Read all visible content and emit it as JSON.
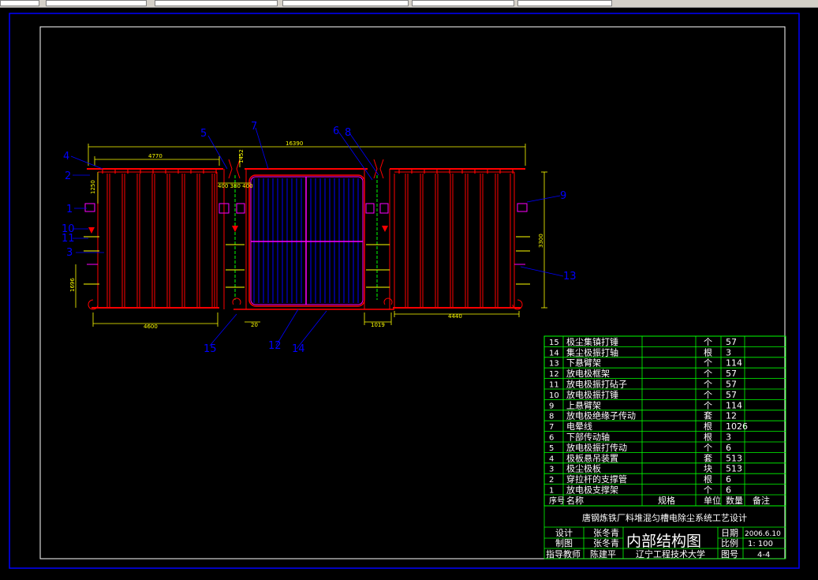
{
  "drawing": {
    "dimensions": {
      "overall": "16390",
      "left_width": "4770",
      "right_top": "1452",
      "mid_spacing": "400 380 400",
      "left_height": "1250",
      "right_height": "3300",
      "left_lower": "1696",
      "bottom_left": "4600",
      "bottom_gap": "20",
      "bottom_mid": "1019",
      "bottom_right": "4440"
    },
    "callouts": {
      "c1": "4",
      "c2": "2",
      "c3": "5",
      "c4": "7",
      "c5": "6",
      "c6": "8",
      "c7": "1",
      "c8": "10",
      "c9": "11",
      "c10": "3",
      "c11": "9",
      "c12": "13",
      "c13": "15",
      "c14": "12",
      "c15": "14"
    }
  },
  "bom": {
    "rows": [
      {
        "no": "15",
        "name": "极尘集镇打锤",
        "spec": "",
        "unit": "个",
        "qty": "57",
        "note": ""
      },
      {
        "no": "14",
        "name": "集尘极振打轴",
        "spec": "",
        "unit": "根",
        "qty": "3",
        "note": ""
      },
      {
        "no": "13",
        "name": "下悬臂架",
        "spec": "",
        "unit": "个",
        "qty": "114",
        "note": ""
      },
      {
        "no": "12",
        "name": "放电极框架",
        "spec": "",
        "unit": "个",
        "qty": "57",
        "note": ""
      },
      {
        "no": "11",
        "name": "放电极振打砧子",
        "spec": "",
        "unit": "个",
        "qty": "57",
        "note": ""
      },
      {
        "no": "10",
        "name": "放电极振打锤",
        "spec": "",
        "unit": "个",
        "qty": "57",
        "note": ""
      },
      {
        "no": "9",
        "name": "上悬臂架",
        "spec": "",
        "unit": "个",
        "qty": "114",
        "note": ""
      },
      {
        "no": "8",
        "name": "放电极绝缘子传动",
        "spec": "",
        "unit": "套",
        "qty": "12",
        "note": ""
      },
      {
        "no": "7",
        "name": "电晕线",
        "spec": "",
        "unit": "根",
        "qty": "1026",
        "note": ""
      },
      {
        "no": "6",
        "name": "下部传动轴",
        "spec": "",
        "unit": "根",
        "qty": "3",
        "note": ""
      },
      {
        "no": "5",
        "name": "放电极振打传动",
        "spec": "",
        "unit": "个",
        "qty": "6",
        "note": ""
      },
      {
        "no": "4",
        "name": "极板悬吊装置",
        "spec": "",
        "unit": "套",
        "qty": "513",
        "note": ""
      },
      {
        "no": "3",
        "name": "极尘极板",
        "spec": "",
        "unit": "块",
        "qty": "513",
        "note": ""
      },
      {
        "no": "2",
        "name": "穿拉杆的支撑管",
        "spec": "",
        "unit": "根",
        "qty": "6",
        "note": ""
      },
      {
        "no": "1",
        "name": "放电极支撑架",
        "spec": "",
        "unit": "个",
        "qty": "6",
        "note": ""
      }
    ],
    "header": {
      "no": "序号",
      "name": "名称",
      "spec": "规格",
      "unit": "单位",
      "qty": "数量",
      "note": "备注"
    }
  },
  "title_block": {
    "project": "唐钢炼铁厂料堆混匀槽电除尘系统工艺设计",
    "design_label": "设计",
    "design_name": "张冬青",
    "draw_label": "制图",
    "draw_name": "张冬青",
    "advisor_label": "指导教师",
    "advisor_name": "陈建平",
    "drawing_title": "内部结构图",
    "school": "辽宁工程技术大学",
    "date_label": "日期",
    "date_value": "2006.6.10",
    "scale_label": "比例",
    "scale_value": "1: 100",
    "sheet_label": "图号",
    "sheet_value": "4-4"
  }
}
